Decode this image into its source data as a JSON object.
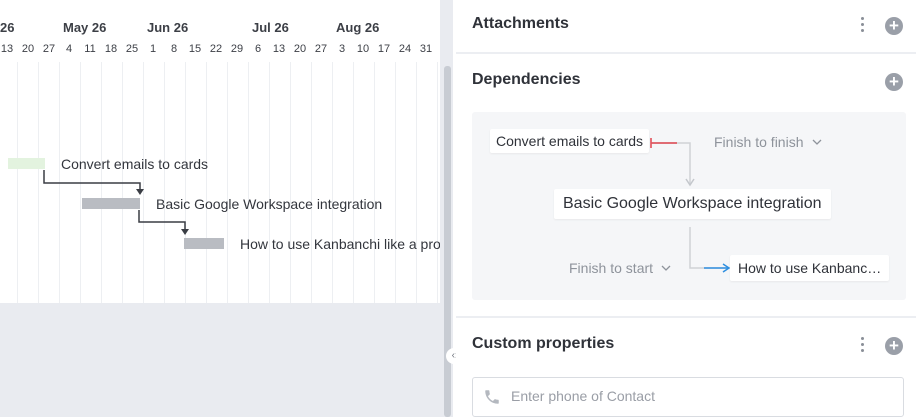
{
  "gantt": {
    "months": [
      "26",
      "May 26",
      "Jun 26",
      "Jul 26",
      "Aug 26"
    ],
    "days": [
      "13",
      "20",
      "27",
      "4",
      "11",
      "18",
      "25",
      "1",
      "8",
      "15",
      "22",
      "29",
      "6",
      "13",
      "20",
      "27",
      "3",
      "10",
      "17",
      "24",
      "31"
    ],
    "tasks": [
      {
        "label": "Convert emails to cards",
        "color": "#e3f3df"
      },
      {
        "label": "Basic Google Workspace integration",
        "color": "#b9bcc2"
      },
      {
        "label": "How to use Kanbanchi like a pro",
        "color": "#b9bcc2"
      }
    ]
  },
  "panel": {
    "attachments": {
      "title": "Attachments"
    },
    "dependencies": {
      "title": "Dependencies",
      "predecessor": "Convert emails to cards",
      "predecessor_type": "Finish to finish",
      "current": "Basic Google Workspace integration",
      "successor_type": "Finish to start",
      "successor": "How to use Kanbanc…",
      "colors": {
        "finish_to_finish": "#e0444e",
        "finish_to_start": "#2f8fe0"
      }
    },
    "custom_properties": {
      "title": "Custom properties",
      "phone_placeholder": "Enter phone of Contact",
      "phone_value": ""
    }
  },
  "icons": {
    "kebab": "kebab-menu-icon",
    "add": "plus-circle-icon",
    "chevron": "chevron-down-icon",
    "phone": "phone-icon",
    "resize": "resize-handle-icon"
  }
}
